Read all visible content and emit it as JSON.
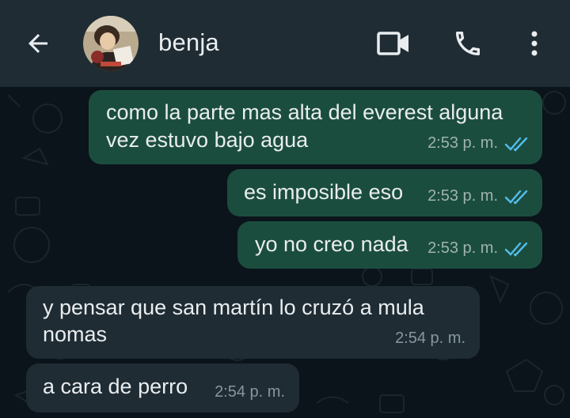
{
  "header": {
    "contact_name": "benja",
    "back_icon": "arrow-left-icon",
    "video_icon": "video-camera-icon",
    "call_icon": "phone-icon",
    "menu_icon": "more-vertical-icon"
  },
  "messages": [
    {
      "direction": "outgoing",
      "lines": [
        "como la parte mas alta del everest alguna",
        "vez estuvo bajo agua"
      ],
      "time": "2:53 p. m.",
      "status": "read"
    },
    {
      "direction": "outgoing",
      "lines": [
        "es imposible eso"
      ],
      "time": "2:53 p. m.",
      "status": "read"
    },
    {
      "direction": "outgoing",
      "lines": [
        "yo no creo nada"
      ],
      "time": "2:53 p. m.",
      "status": "read"
    },
    {
      "direction": "incoming",
      "lines": [
        "y pensar que san martín lo cruzó a mula",
        "nomas"
      ],
      "time": "2:54 p. m."
    },
    {
      "direction": "incoming",
      "lines": [
        "a cara de perro"
      ],
      "time": "2:54 p. m."
    }
  ],
  "colors": {
    "header_bg": "#1f2c34",
    "chat_bg": "#0b141a",
    "outgoing_bubble": "#1b4d3e",
    "incoming_bubble": "#1f2c34",
    "read_ticks": "#53bdeb"
  }
}
